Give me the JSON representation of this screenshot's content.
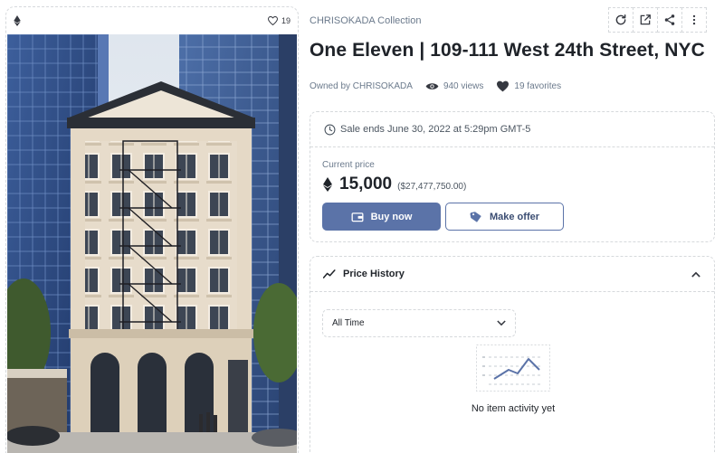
{
  "asset": {
    "favorites_count": "19",
    "collection": "CHRISOKADA Collection",
    "title": "One Eleven | 109-111 West 24th Street, NYC",
    "owner": "Owned by CHRISOKADA",
    "views": "940 views",
    "favorites": "19 favorites"
  },
  "toolbar": {
    "icons": [
      "refresh-icon",
      "external-link-icon",
      "share-icon",
      "more-vertical-icon"
    ]
  },
  "sale": {
    "ends": "Sale ends June 30, 2022 at 5:29pm GMT-5",
    "current_price_label": "Current price",
    "price": "15,000",
    "usd": "($27,477,750.00)",
    "buy_label": "Buy now",
    "offer_label": "Make offer"
  },
  "price_history": {
    "title": "Price History",
    "filter": "All Time",
    "empty": "No item activity yet"
  },
  "colors": {
    "accent": "#5b73a8",
    "text": "#1f2329",
    "muted": "#6b7a8c",
    "border": "#d6d9dc"
  }
}
